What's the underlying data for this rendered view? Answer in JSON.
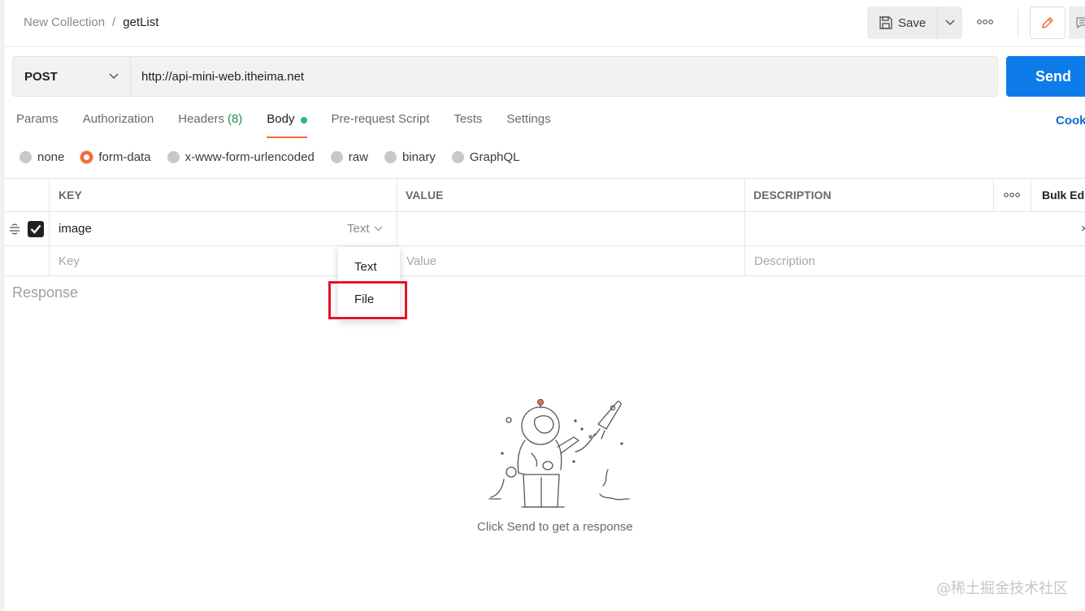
{
  "header": {
    "collection": "New Collection",
    "separator": "/",
    "request_name": "getList",
    "save_label": "Save"
  },
  "request": {
    "method": "POST",
    "url": "http://api-mini-web.itheima.net",
    "send_label": "Send"
  },
  "tabs": [
    {
      "label": "Params"
    },
    {
      "label": "Authorization"
    },
    {
      "label": "Headers",
      "count": "(8)"
    },
    {
      "label": "Body",
      "active": true
    },
    {
      "label": "Pre-request Script"
    },
    {
      "label": "Tests"
    },
    {
      "label": "Settings"
    }
  ],
  "cookies_label": "Cook",
  "body_types": [
    {
      "label": "none"
    },
    {
      "label": "form-data",
      "checked": true
    },
    {
      "label": "x-www-form-urlencoded"
    },
    {
      "label": "raw"
    },
    {
      "label": "binary"
    },
    {
      "label": "GraphQL"
    }
  ],
  "table": {
    "headers": {
      "key": "KEY",
      "value": "VALUE",
      "description": "DESCRIPTION",
      "bulk_edit": "Bulk Ed"
    },
    "row": {
      "key": "image",
      "type": "Text",
      "value": "",
      "description": ""
    },
    "placeholders": {
      "key": "Key",
      "value": "Value",
      "description": "Description"
    }
  },
  "type_dropdown": {
    "options": [
      "Text",
      "File"
    ],
    "highlighted": "File"
  },
  "response": {
    "label": "Response",
    "empty_message": "Click Send to get a response"
  },
  "watermark": "@稀土掘金技术社区",
  "colors": {
    "accent": "#f26b3a",
    "send": "#0e7bea",
    "body_dot": "#26b47f",
    "highlight": "#e3142b"
  }
}
